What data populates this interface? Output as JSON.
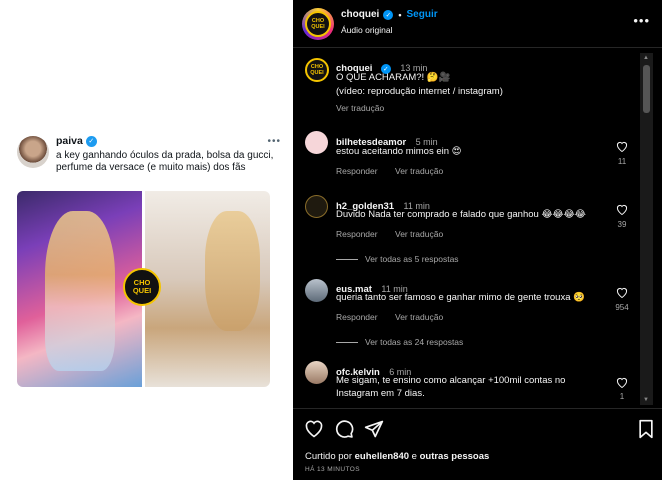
{
  "tweet": {
    "name": "paiva",
    "text": "a key ganhando óculos da prada, bolsa da gucci, perfume da versace (e muito mais) dos fãs",
    "badge_text": "CHO QUEI"
  },
  "post": {
    "username": "choquei",
    "follow_label": "Seguir",
    "audio_label": "Áudio original",
    "logo_text": "CHO QUEI",
    "caption_time": "13 min",
    "caption_line1": "O QUE ACHARAM?! 🤔🎥",
    "caption_line2": "(vídeo: reprodução internet / instagram)",
    "see_translation": "Ver tradução"
  },
  "comments": [
    {
      "user": "bilhetesdeamor",
      "time": "5 min",
      "text": "estou aceitando mimos ein 😍",
      "likes": "11",
      "reply": "Responder",
      "translate": "Ver tradução"
    },
    {
      "user": "h2_golden31",
      "time": "11 min",
      "text": "Duvido Nada ter comprado e falado que ganhou 😂😂😂😂",
      "likes": "39",
      "reply": "Responder",
      "translate": "Ver tradução",
      "replies": "Ver todas as 5 respostas"
    },
    {
      "user": "eus.mat",
      "time": "11 min",
      "text": "queria tanto ser famoso e ganhar mimo de gente trouxa 🥺",
      "likes": "954",
      "reply": "Responder",
      "translate": "Ver tradução",
      "replies": "Ver todas as 24 respostas"
    },
    {
      "user": "ofc.kelvin",
      "time": "6 min",
      "text": "Me sigam, te ensino como alcançar +100mil contas no Instagram em 7 dias.",
      "likes": "1"
    }
  ],
  "footer": {
    "liked_prefix": "Curtido por ",
    "liked_user": "euhellen840",
    "liked_mid": " e ",
    "liked_others": "outras pessoas",
    "time_ago": "HÁ 13 MINUTOS"
  },
  "colors": {
    "accent_blue": "#0095f6",
    "brand_yellow": "#f4c400",
    "twitter_blue": "#1d9bf0"
  }
}
